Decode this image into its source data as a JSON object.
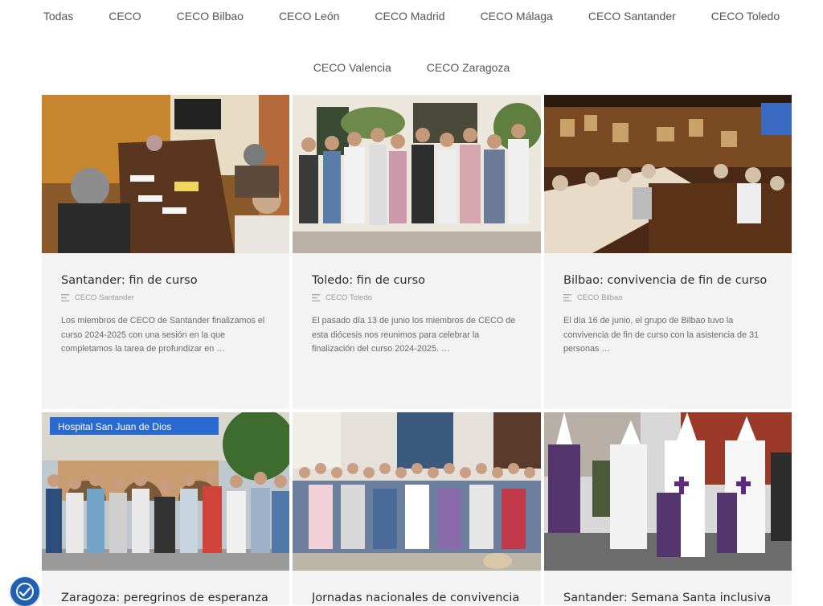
{
  "filters": {
    "row1": [
      "Todas",
      "CECO",
      "CECO Bilbao",
      "CECO León",
      "CECO Madrid",
      "CECO Málaga",
      "CECO Santander",
      "CECO Toledo"
    ],
    "row2": [
      "CECO Valencia",
      "CECO Zaragoza"
    ]
  },
  "posts": [
    {
      "title": "Santander: fin de curso",
      "category": "CECO Santander",
      "excerpt": "Los miembros de CECO de Santander finalizamos el curso 2024-2025 con una sesión en la que completamos la tarea de profundizar en …",
      "photo": "meeting-table"
    },
    {
      "title": "Toledo: fin de curso",
      "category": "CECO Toledo",
      "excerpt": "El pasado día 13 de junio los miembros de CECO de esta diócesis nos reunimos para celebrar la finalización del curso 2024-2025. …",
      "photo": "group-courtyard"
    },
    {
      "title": "Bilbao: convivencia de fin de curso",
      "category": "CECO Bilbao",
      "excerpt": "El día 16 de junio, el grupo de Bilbao tuvo la convivencia de fin de curso con la asistencia de 31 personas …",
      "photo": "restaurant"
    },
    {
      "title": "Zaragoza: peregrinos de esperanza en",
      "category": "",
      "excerpt": "",
      "photo": "hospital-group",
      "sign_text": "Hospital  San Juan de Dios"
    },
    {
      "title": "Jornadas nacionales de convivencia en",
      "category": "",
      "excerpt": "",
      "photo": "church-group"
    },
    {
      "title": "Santander: Semana Santa inclusiva en",
      "category": "",
      "excerpt": "",
      "photo": "procession"
    }
  ],
  "accessibility": {
    "icon": "accessibility-icon",
    "color": "#1f5fb4"
  }
}
